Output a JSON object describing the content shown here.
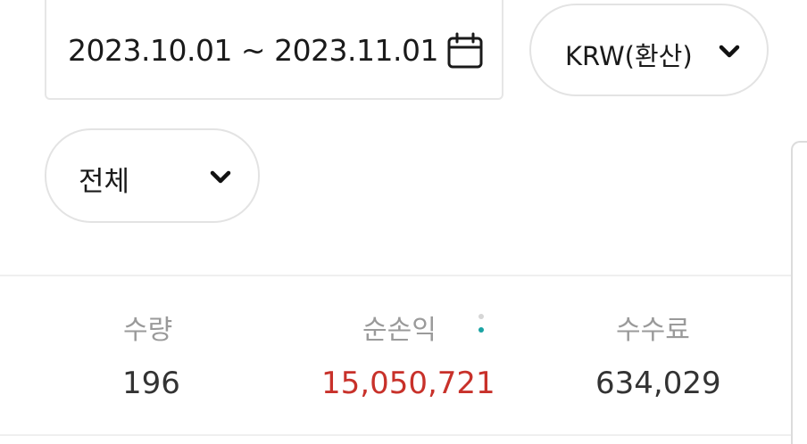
{
  "filters": {
    "date_range": "2023.10.01 ~ 2023.11.01",
    "currency": "KRW(환산)",
    "category": "전체"
  },
  "summary": {
    "quantity_label": "수량",
    "quantity_value": "196",
    "profit_label": "순손익",
    "profit_value": "15,050,721",
    "fee_label": "수수료",
    "fee_value": "634,029"
  },
  "colors": {
    "profit_positive": "#c8312a",
    "info_dot": "#1aa3a3",
    "label_gray": "#9a9a9a"
  },
  "icons": {
    "calendar": "calendar-icon",
    "dropdown": "chevron-down-icon",
    "info": "info-dots-icon"
  }
}
